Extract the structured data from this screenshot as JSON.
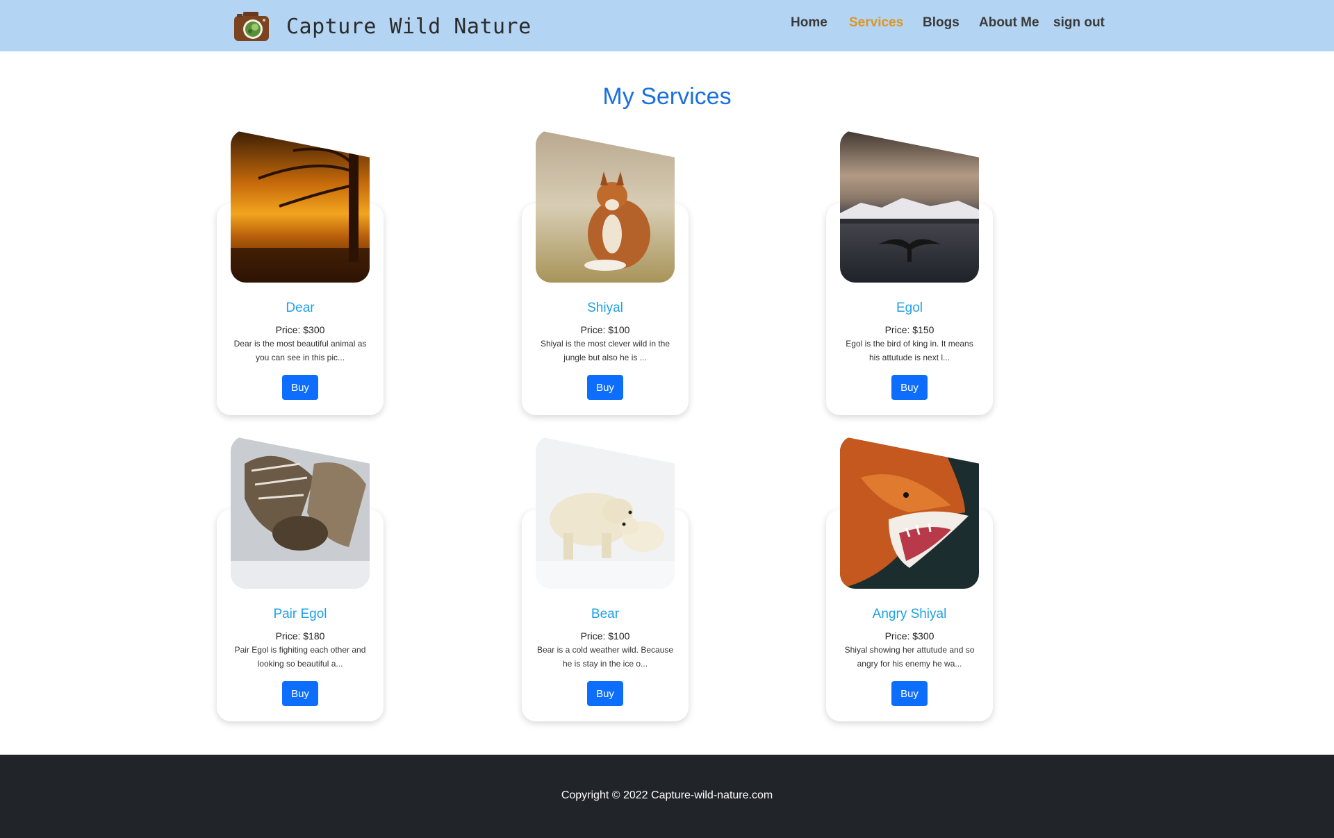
{
  "header": {
    "brand": "Capture Wild Nature",
    "nav": [
      {
        "label": "Home",
        "active": false
      },
      {
        "label": "Services",
        "active": true
      },
      {
        "label": "Blogs",
        "active": false
      },
      {
        "label": "About Me",
        "active": false
      },
      {
        "label": "sign out",
        "active": false
      }
    ],
    "colors": {
      "background": "#b3d4f3",
      "active": "#e0951f"
    }
  },
  "main": {
    "title": "My Services",
    "services": [
      {
        "name": "Dear",
        "price": "Price: $300",
        "description": "Dear is the most beautiful animal as you can see in this pic...",
        "button": "Buy",
        "image": "sunset-tree-photo"
      },
      {
        "name": "Shiyal",
        "price": "Price: $100",
        "description": "Shiyal is the most clever wild in the jungle but also he is ...",
        "button": "Buy",
        "image": "fox-sitting-photo"
      },
      {
        "name": "Egol",
        "price": "Price: $150",
        "description": "Egol is the bird of king in. It means his attutude is next l...",
        "button": "Buy",
        "image": "whale-tail-photo"
      },
      {
        "name": "Pair Egol",
        "price": "Price: $180",
        "description": "Pair Egol is fighiting each other and looking so beautiful a...",
        "button": "Buy",
        "image": "eagles-fighting-photo"
      },
      {
        "name": "Bear",
        "price": "Price: $100",
        "description": "Bear is a cold weather wild. Because he is stay in the ice o...",
        "button": "Buy",
        "image": "polar-bears-photo"
      },
      {
        "name": "Angry Shiyal",
        "price": "Price: $300",
        "description": "Shiyal showing her attutude and so angry for his enemy he wa...",
        "button": "Buy",
        "image": "angry-fox-photo"
      }
    ],
    "colors": {
      "title": "#1a6fe0",
      "card_title": "#1ea0e6",
      "button": "#0d6efd"
    }
  },
  "footer": {
    "copyright": "Copyright © 2022 Capture-wild-nature.com"
  }
}
